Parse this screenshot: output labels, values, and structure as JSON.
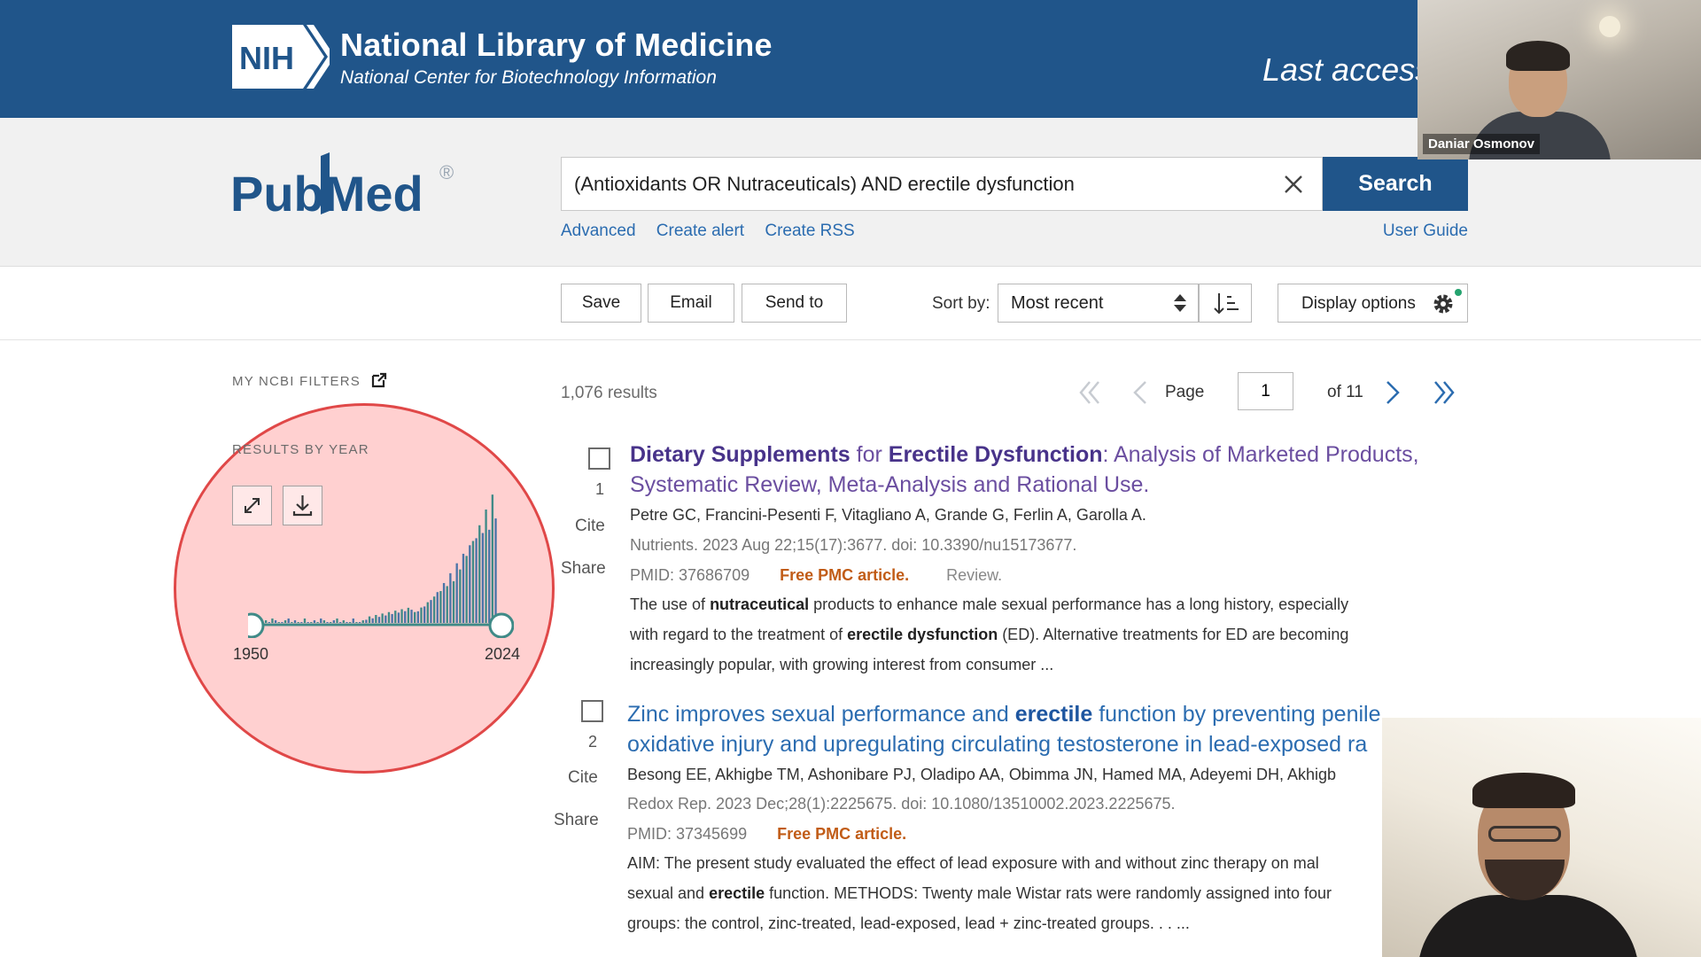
{
  "banner": {
    "logo_text": "NIH",
    "title": "National Library of Medicine",
    "subtitle": "National Center for Biotechnology Information",
    "last_access": "Last access"
  },
  "video": {
    "top_participant_name": "Daniar Osmonov"
  },
  "pubmed": {
    "logo_text": "PubMed",
    "logo_mark": "®",
    "search_value": "(Antioxidants OR Nutraceuticals) AND erectile dysfunction",
    "search_button": "Search",
    "links": [
      "Advanced",
      "Create alert",
      "Create RSS"
    ],
    "user_guide": "User Guide"
  },
  "actions": {
    "save": "Save",
    "email": "Email",
    "send_to": "Send to",
    "sort_label": "Sort by:",
    "sort_value": "Most recent",
    "display_options": "Display options"
  },
  "sidebar": {
    "filters_label": "MY NCBI FILTERS",
    "results_by_year": "RESULTS BY YEAR",
    "year_start": "1950",
    "year_end": "2024"
  },
  "pager": {
    "results_count": "1,076 results",
    "page_label": "Page",
    "page_value": "1",
    "of_label": "of 11"
  },
  "results": [
    {
      "rank": "1",
      "cite": "Cite",
      "share": "Share",
      "title_b1": "Dietary Supplements",
      "title_t1": " for ",
      "title_b2": "Erectile Dysfunction",
      "title_t2": ": Analysis of Marketed Products,",
      "title_line2": "Systematic Review, Meta-Analysis and Rational Use.",
      "authors": "Petre GC, Francini-Pesenti F, Vitagliano A, Grande G, Ferlin A, Garolla A.",
      "citation": "Nutrients. 2023 Aug 22;15(17):3677. doi: 10.3390/nu15173677.",
      "pmid": "PMID: 37686709",
      "free": "Free PMC article.",
      "type": "Review.",
      "s1a": "The use of ",
      "s1b": "nutraceutical",
      "s1c": " products to enhance male sexual performance has a long history, especially",
      "s2a": "with regard to the treatment of ",
      "s2b": "erectile dysfunction",
      "s2c": " (ED). Alternative treatments for ED are becoming",
      "s3": "increasingly popular, with growing interest from consumer ..."
    },
    {
      "rank": "2",
      "cite": "Cite",
      "share": "Share",
      "title_t1": "Zinc improves sexual performance and ",
      "title_b1": "erectile",
      "title_t2": " function by preventing penile",
      "title_line2": "oxidative injury and upregulating circulating testosterone in lead-exposed ra",
      "authors": "Besong EE, Akhigbe TM, Ashonibare PJ, Oladipo AA, Obimma JN, Hamed MA, Adeyemi DH, Akhigb",
      "citation": "Redox Rep. 2023 Dec;28(1):2225675. doi: 10.1080/13510002.2023.2225675.",
      "pmid": "PMID: 37345699",
      "free": "Free PMC article.",
      "s1": "AIM: The present study evaluated the effect of lead exposure with and without zinc therapy on mal",
      "s2a": "sexual and ",
      "s2b": "erectile",
      "s2c": " function. METHODS: Twenty male Wistar rats were randomly assigned into four",
      "s3": "groups: the control, zinc-treated, lead-exposed, lead + zinc-treated groups. . . ..."
    }
  ],
  "icons": {
    "clear": "close-icon",
    "sort_arrows": "sort-updown-icon",
    "sort_direction": "sort-descending-icon",
    "display_gear": "gear-icon",
    "external": "external-link-icon",
    "expand": "expand-icon",
    "download": "download-icon",
    "first": "double-chevron-left-icon",
    "prev": "chevron-left-icon",
    "next": "chevron-right-icon",
    "last": "double-chevron-right-icon"
  },
  "colors": {
    "nih_blue": "#20558a",
    "visited_title": "#6b4ea0",
    "link_blue": "#2b6cb0",
    "free_pmc": "#c15c17",
    "highlight": "#e04848",
    "histogram": "#3f8a87"
  }
}
